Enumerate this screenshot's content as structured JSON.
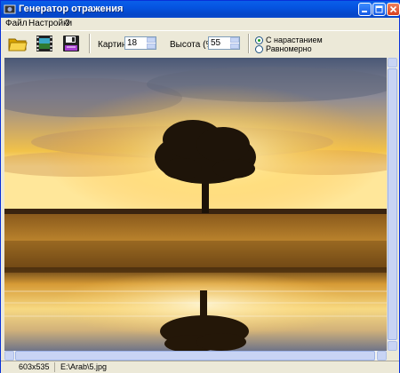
{
  "window": {
    "title": "Генератор отражения"
  },
  "menu": {
    "items": [
      "Файл",
      "Настройки",
      "?"
    ]
  },
  "toolbar": {
    "icons": [
      "open-folder-icon",
      "film-strip-icon",
      "save-floppy-icon"
    ],
    "pictures_label": "Картин :",
    "pictures_value": "18",
    "height_label": "Высота (%) :",
    "height_value": "55",
    "mode_options": [
      "С нарастанием",
      "Равномерно"
    ],
    "mode_selected": "С нарастанием"
  },
  "status": {
    "dimensions": "603x535",
    "file_path": "E:\\Arab\\5.jpg"
  },
  "colors": {
    "titlebar": "#0553e0",
    "chrome": "#ece9d8",
    "radio_dot": "#21a121"
  }
}
